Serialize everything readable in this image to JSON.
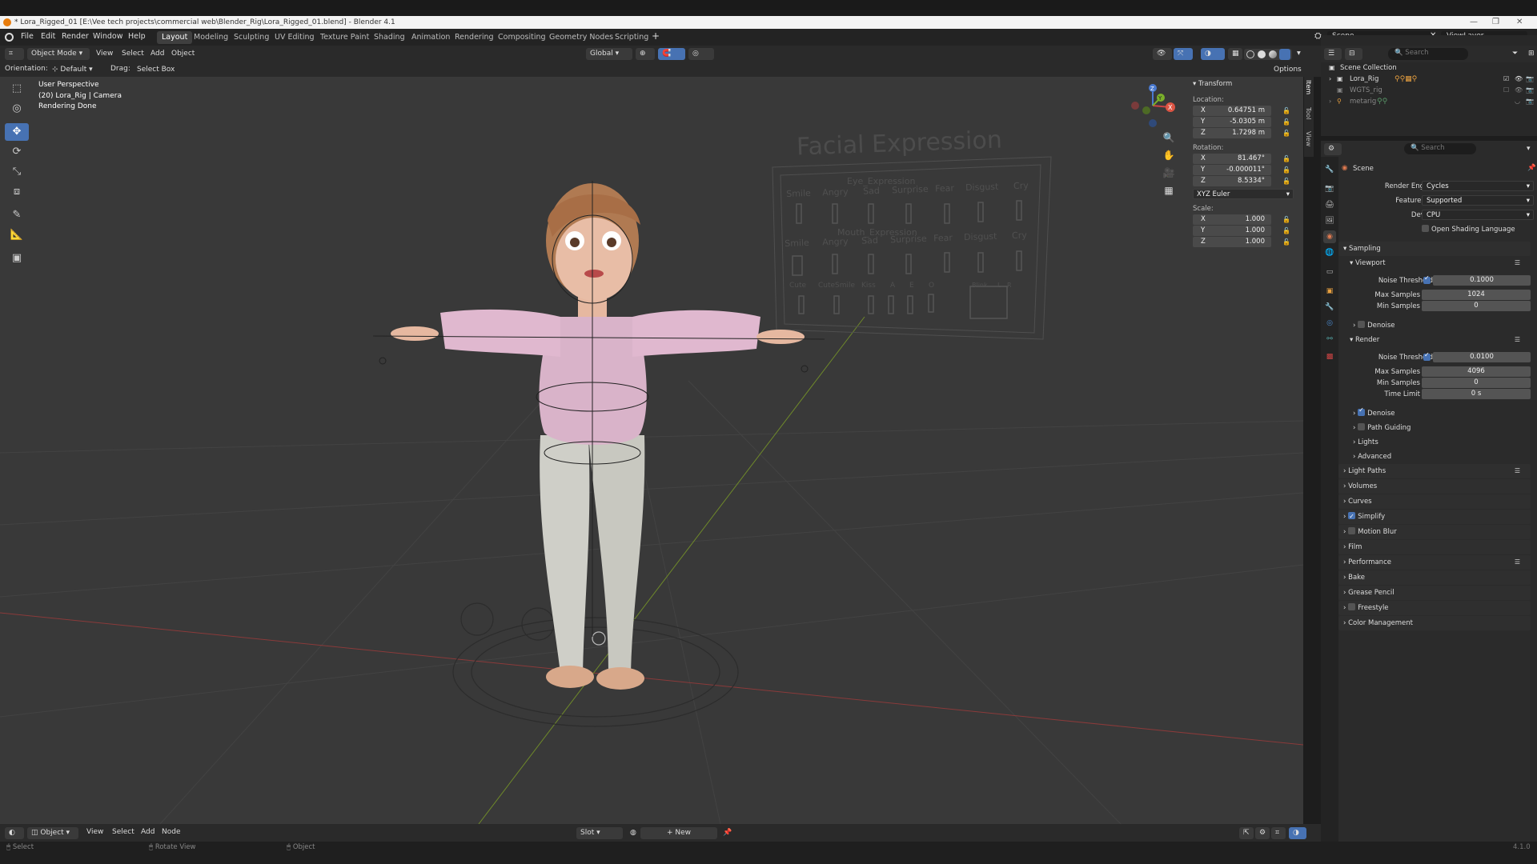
{
  "window": {
    "title": "* Lora_Rigged_01 [E:\\Vee tech projects\\commercial web\\Blender_Rig\\Lora_Rigged_01.blend] - Blender 4.1"
  },
  "menu": [
    "File",
    "Edit",
    "Render",
    "Window",
    "Help"
  ],
  "workspaces": [
    "Layout",
    "Modeling",
    "Sculpting",
    "UV Editing",
    "Texture Paint",
    "Shading",
    "Animation",
    "Rendering",
    "Compositing",
    "Geometry Nodes",
    "Scripting"
  ],
  "active_workspace": "Layout",
  "scene_selector": "Scene",
  "viewlayer_selector": "ViewLayer",
  "viewport_header": {
    "mode": "Object Mode",
    "menus": [
      "View",
      "Select",
      "Add",
      "Object"
    ],
    "transform_orientation": "Global",
    "options_label": "Options"
  },
  "tool_header": {
    "orientation_label": "Orientation:",
    "orientation_value": "Default",
    "drag_label": "Drag:",
    "drag_value": "Select Box"
  },
  "viewport_overlay": {
    "line1": "User Perspective",
    "line2": "(20) Lora_Rig | Camera",
    "line3": "Rendering Done"
  },
  "board": {
    "title": "Facial Expression",
    "eye_title": "Eye_Expression",
    "eye_labels": [
      "Smile",
      "Angry",
      "Sad",
      "Surprise",
      "Fear",
      "Disgust",
      "Cry"
    ],
    "mouth_title": "Mouth_Expression",
    "mouth_labels": [
      "Smile",
      "Angry",
      "Sad",
      "Surprise",
      "Fear",
      "Disgust",
      "Cry"
    ],
    "viseme_labels": [
      "Cute",
      "CuteSmile",
      "Kiss",
      "A",
      "E",
      "O"
    ],
    "blink_label": "Blink",
    "lr_labels": [
      "L",
      "R"
    ]
  },
  "gizmo": {
    "x": "X",
    "y": "Y",
    "z": "Z"
  },
  "transform_panel": {
    "title": "Transform",
    "location_label": "Location:",
    "location": [
      {
        "axis": "X",
        "value": "0.64751 m"
      },
      {
        "axis": "Y",
        "value": "-5.0305 m"
      },
      {
        "axis": "Z",
        "value": "1.7298 m"
      }
    ],
    "rotation_label": "Rotation:",
    "rotation": [
      {
        "axis": "X",
        "value": "81.467°"
      },
      {
        "axis": "Y",
        "value": "-0.000011°"
      },
      {
        "axis": "Z",
        "value": "8.5334°"
      }
    ],
    "rotation_mode": "XYZ Euler",
    "scale_label": "Scale:",
    "scale": [
      {
        "axis": "X",
        "value": "1.000"
      },
      {
        "axis": "Y",
        "value": "1.000"
      },
      {
        "axis": "Z",
        "value": "1.000"
      }
    ]
  },
  "side_tabs": [
    "Item",
    "Tool",
    "View"
  ],
  "bottom_header": {
    "mode": "Object",
    "menus": [
      "View",
      "Select",
      "Add",
      "Node"
    ],
    "slot": "Slot",
    "new": "New"
  },
  "status_bar": {
    "select": "Select",
    "rotate": "Rotate View",
    "object": "Object",
    "version": "4.1.0"
  },
  "outliner": {
    "search_placeholder": "Search",
    "rows": [
      {
        "label": "Scene Collection",
        "indent": 0
      },
      {
        "label": "Lora_Rig",
        "indent": 1
      },
      {
        "label": "WGTS_rig",
        "indent": 1
      },
      {
        "label": "metarig",
        "indent": 1
      }
    ]
  },
  "properties": {
    "search_placeholder": "Search",
    "context": "Scene",
    "render_engine_label": "Render Engine",
    "render_engine": "Cycles",
    "feature_set_label": "Feature Set",
    "feature_set": "Supported",
    "device_label": "Device",
    "device": "CPU",
    "osl_label": "Open Shading Language",
    "sampling": "Sampling",
    "viewport": "Viewport",
    "vp_noise_label": "Noise Threshold",
    "vp_noise": "0.1000",
    "vp_max_label": "Max Samples",
    "vp_max": "1024",
    "vp_min_label": "Min Samples",
    "vp_min": "0",
    "vp_denoise": "Denoise",
    "render": "Render",
    "r_noise_label": "Noise Threshold",
    "r_noise": "0.0100",
    "r_max_label": "Max Samples",
    "r_max": "4096",
    "r_min_label": "Min Samples",
    "r_min": "0",
    "r_time_label": "Time Limit",
    "r_time": "0 s",
    "r_denoise": "Denoise",
    "path_guiding": "Path Guiding",
    "lights": "Lights",
    "advanced": "Advanced",
    "sections": [
      "Light Paths",
      "Volumes",
      "Curves",
      "Simplify",
      "Motion Blur",
      "Film",
      "Performance",
      "Bake",
      "Grease Pencil",
      "Freestyle",
      "Color Management"
    ]
  }
}
